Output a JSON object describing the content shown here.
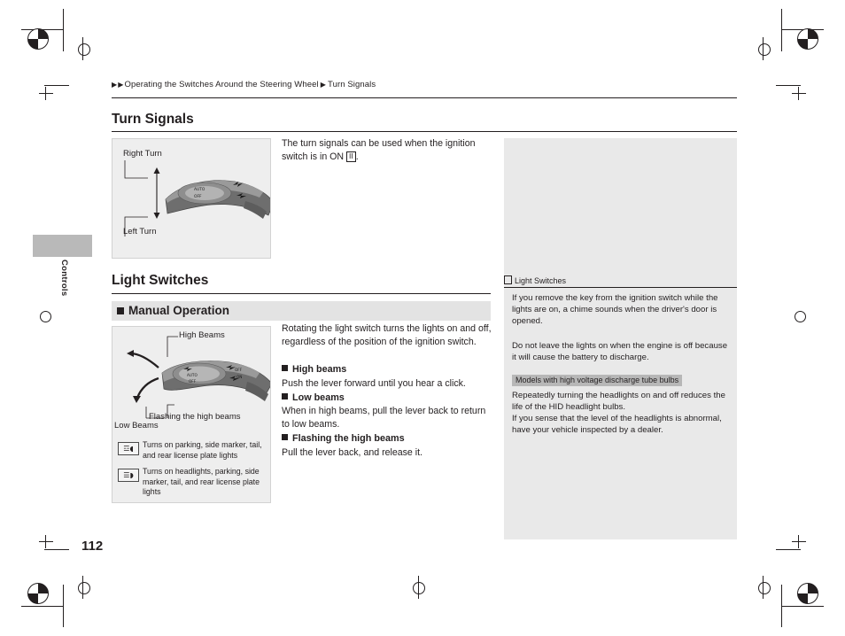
{
  "breadcrumb": {
    "arrow": "▶",
    "part1": "Operating the Switches Around the Steering Wheel",
    "sep": "▶",
    "part2": "Turn Signals"
  },
  "side_tab": {
    "label": "Controls"
  },
  "sections": {
    "turn_signals": {
      "title": "Turn Signals",
      "figure": {
        "label_right": "Right Turn",
        "label_left": "Left Turn"
      },
      "intro_1": "The turn signals can be used when the ignition",
      "intro_2": "switch is in ON",
      "intro_key": "II",
      "intro_3": "."
    },
    "light_switches": {
      "title": "Light Switches",
      "subsection": "Manual Operation",
      "figure": {
        "label_high": "High Beams",
        "label_flashing": "Flashing the high beams",
        "label_low": "Low Beams",
        "lever_texts": [
          "AUTO",
          "OFF",
          "ON"
        ]
      },
      "legend": [
        {
          "icon": "☲◖",
          "text": "Turns on parking, side marker, tail, and rear license plate lights"
        },
        {
          "icon": "☰◗",
          "text": "Turns on headlights, parking, side marker, tail, and rear license plate lights"
        }
      ],
      "body_intro": "Rotating the light switch turns the lights on and off, regardless of the position of the ignition switch.",
      "items": [
        {
          "heading": "High beams",
          "text": "Push the lever forward until you hear a click."
        },
        {
          "heading": "Low beams",
          "text": "When in high beams, pull the lever back to return to low beams."
        },
        {
          "heading": "Flashing the high beams",
          "text": "Pull the lever back, and release it."
        }
      ]
    }
  },
  "info": {
    "title": "Light Switches",
    "paragraphs": [
      "If you remove the key from the ignition switch while the lights are on, a chime sounds when the driver's door is opened.",
      "Do not leave the lights on when the engine is off because it will cause the battery to discharge."
    ],
    "highlight": "Models with high voltage discharge tube bulbs",
    "paragraphs_after": [
      "Repeatedly turning the headlights on and off reduces the life of the HID headlight bulbs.",
      "If you sense that the level of the headlights is abnormal, have your vehicle inspected by a dealer."
    ]
  },
  "page_number": "112"
}
